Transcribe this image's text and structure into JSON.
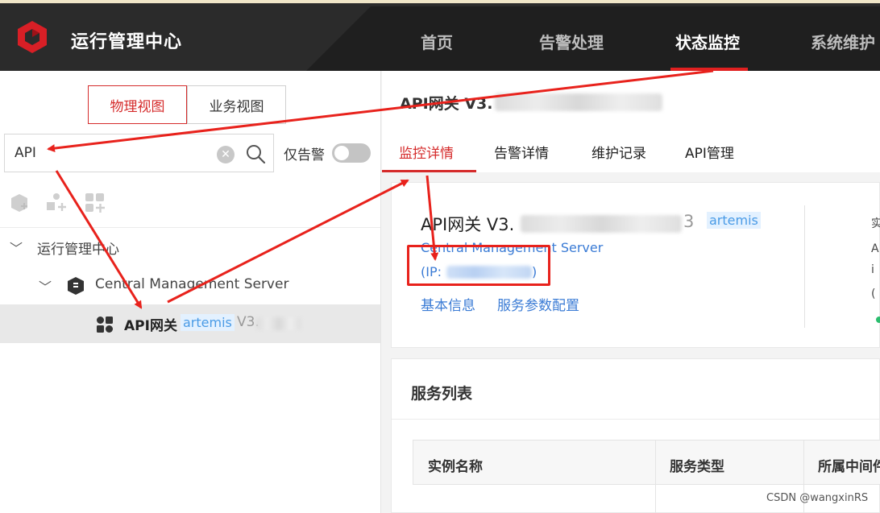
{
  "header": {
    "app_title": "运行管理中心",
    "nav": [
      "首页",
      "告警处理",
      "状态监控",
      "系统维护"
    ],
    "active_nav": "状态监控"
  },
  "sidebar": {
    "view_tabs": [
      "物理视图",
      "业务视图"
    ],
    "active_view": "物理视图",
    "search_value": "API",
    "alarm_only_label": "仅告警",
    "tree": {
      "root_label": "运行管理中心",
      "server_label": "Central Management Server",
      "node_label": "API网关",
      "node_tag": "artemis",
      "node_version_prefix": "V3."
    }
  },
  "main": {
    "page_title": "API网关 V3.",
    "tabs": [
      "监控详情",
      "告警详情",
      "维护记录",
      "API管理"
    ],
    "active_tab": "监控详情",
    "detail": {
      "title": "API网关 V3.",
      "title_suffix": "3",
      "tag": "artemis",
      "server_link": "Central Management Server",
      "ip_prefix": "(IP:",
      "ip_suffix": ")",
      "links": [
        "基本信息",
        "服务参数配置"
      ],
      "edge_chars": [
        "实",
        "A",
        "i",
        "("
      ]
    },
    "service_list": {
      "title": "服务列表",
      "columns": [
        "实例名称",
        "服务类型",
        "所属中间件"
      ]
    }
  },
  "watermark": "CSDN @wangxinRS",
  "colors": {
    "accent_red": "#d52b2b",
    "annotation_red": "#e8221c",
    "topbar": "#2b2b2b",
    "link_blue": "#3a7bd5"
  }
}
